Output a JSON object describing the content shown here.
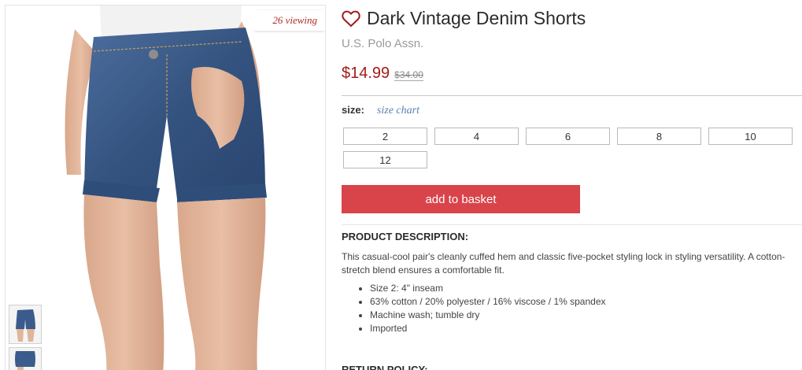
{
  "gallery": {
    "viewing_badge": "26 viewing",
    "thumbnails": [
      "shorts-front-thumb",
      "shorts-side-thumb"
    ]
  },
  "product": {
    "title": "Dark Vintage Denim Shorts",
    "brand": "U.S. Polo Assn.",
    "price": "$14.99",
    "original_price": "$34.00",
    "favorite_icon": "heart-outline-icon"
  },
  "size": {
    "label": "size:",
    "chart_link": "size chart",
    "options": [
      "2",
      "4",
      "6",
      "8",
      "10",
      "12"
    ]
  },
  "actions": {
    "add_to_basket": "add to basket"
  },
  "description": {
    "heading": "PRODUCT DESCRIPTION:",
    "text": "This casual-cool pair's cleanly cuffed hem and classic five-pocket styling lock in styling versatility. A cotton-stretch blend ensures a comfortable fit.",
    "bullets": [
      "Size 2: 4\" inseam",
      "63% cotton / 20% polyester / 16% viscose / 1% spandex",
      "Machine wash; tumble dry",
      "Imported"
    ]
  },
  "return_policy": {
    "heading": "RETURN POLICY:"
  },
  "colors": {
    "price_red": "#a31a1a",
    "button_red": "#d9434a",
    "link_blue": "#5b7fb3",
    "denim": "#3b5b8c"
  }
}
